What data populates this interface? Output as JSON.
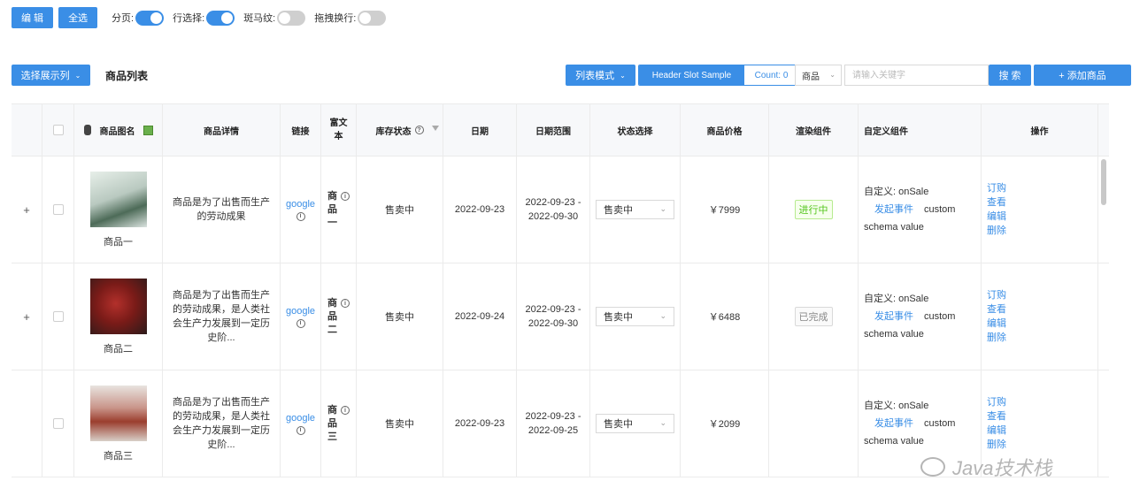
{
  "topbar": {
    "edit_label": "编 辑",
    "select_all_label": "全选",
    "toggles": [
      {
        "label": "分页:",
        "on": true
      },
      {
        "label": "行选择:",
        "on": true
      },
      {
        "label": "斑马纹:",
        "on": false
      },
      {
        "label": "拖拽换行:",
        "on": false
      }
    ]
  },
  "toolbar": {
    "column_select_label": "选择展示列",
    "list_title": "商品列表",
    "mode_label": "列表模式",
    "header_slot_label": "Header Slot Sample",
    "header_slot_count": "Count: 0",
    "search_category": "商品",
    "search_placeholder": "请输入关键字",
    "search_label": "搜 索",
    "add_label": "+ 添加商品"
  },
  "table": {
    "headers": {
      "image": "商品图名",
      "detail": "商品详情",
      "link": "链接",
      "rich_line1": "富文",
      "rich_line2": "本",
      "stock": "库存状态",
      "date": "日期",
      "range": "日期范围",
      "status": "状态选择",
      "price": "商品价格",
      "render": "渲染组件",
      "custom": "自定义组件",
      "op": "操作"
    },
    "rows": [
      {
        "expander": "+",
        "name": "商品一",
        "detail": "商品是为了出售而生产的劳动成果",
        "link": "google",
        "rich": [
          "商",
          "品",
          "一"
        ],
        "stock": "售卖中",
        "date": "2022-09-23",
        "range_start": "2022-09-23 -",
        "range_end": "2022-09-30",
        "status": "售卖中",
        "price": "￥7999",
        "render_tag": "进行中",
        "custom_line1": "自定义: onSale",
        "custom_event": "发起事件",
        "custom_tail": "custom",
        "custom_line3": "schema value",
        "ops": [
          "订购",
          "查看",
          "编辑",
          "删除"
        ]
      },
      {
        "expander": "+",
        "name": "商品二",
        "detail": "商品是为了出售而生产的劳动成果，是人类社会生产力发展到一定历史阶...",
        "link": "google",
        "rich": [
          "商",
          "品",
          "二"
        ],
        "stock": "售卖中",
        "date": "2022-09-24",
        "range_start": "2022-09-23 -",
        "range_end": "2022-09-30",
        "status": "售卖中",
        "price": "￥6488",
        "render_tag": "已完成",
        "custom_line1": "自定义: onSale",
        "custom_event": "发起事件",
        "custom_tail": "custom",
        "custom_line3": "schema value",
        "ops": [
          "订购",
          "查看",
          "编辑",
          "删除"
        ]
      },
      {
        "expander": "",
        "name": "商品三",
        "detail": "商品是为了出售而生产的劳动成果，是人类社会生产力发展到一定历史阶...",
        "link": "google",
        "rich": [
          "商",
          "品",
          "三"
        ],
        "stock": "售卖中",
        "date": "2022-09-23",
        "range_start": "2022-09-23 -",
        "range_end": "2022-09-25",
        "status": "售卖中",
        "price": "￥2099",
        "render_tag": "",
        "custom_line1": "自定义: onSale",
        "custom_event": "发起事件",
        "custom_tail": "custom",
        "custom_line3": "schema value",
        "ops": [
          "订购",
          "查看",
          "编辑",
          "删除"
        ]
      }
    ]
  },
  "watermark": "Java技术栈",
  "colors": {
    "primary": "#3a8ee6",
    "success": "#52c41a",
    "border": "#ebebeb"
  }
}
